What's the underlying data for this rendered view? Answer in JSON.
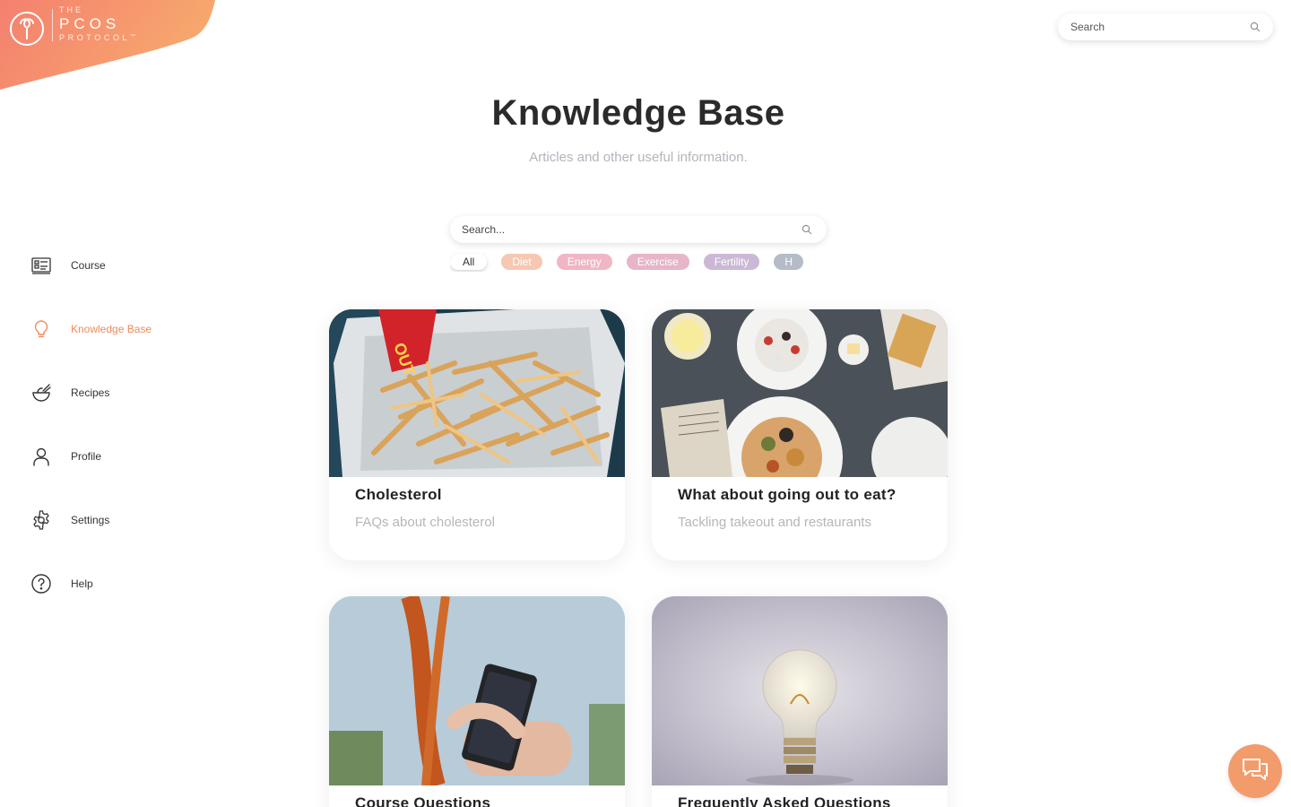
{
  "brand": {
    "line1": "THE",
    "line2": "PCOS",
    "line3": "PROTOCOL",
    "trademark": "™",
    "color_start": "#f5836f",
    "color_end": "#f7a86e"
  },
  "top_search": {
    "placeholder": "Search"
  },
  "header": {
    "title": "Knowledge Base",
    "subtitle": "Articles and other useful information."
  },
  "main_search": {
    "placeholder": "Search..."
  },
  "categories": [
    {
      "label": "All",
      "color": "#ffffff",
      "selected": true
    },
    {
      "label": "Diet",
      "color": "#f6c7b2"
    },
    {
      "label": "Energy",
      "color": "#f0b6c3"
    },
    {
      "label": "Exercise",
      "color": "#e6b5c9"
    },
    {
      "label": "Fertility",
      "color": "#cbb8d6"
    },
    {
      "label": "H",
      "color": "#b5bcc8"
    }
  ],
  "sidebar": {
    "items": [
      {
        "label": "Course",
        "icon": "course-icon"
      },
      {
        "label": "Knowledge Base",
        "icon": "lightbulb-icon",
        "active": true
      },
      {
        "label": "Recipes",
        "icon": "bowl-icon"
      },
      {
        "label": "Profile",
        "icon": "user-icon"
      },
      {
        "label": "Settings",
        "icon": "gear-icon"
      },
      {
        "label": "Help",
        "icon": "question-icon"
      }
    ],
    "accent": "#ef8a57"
  },
  "cards": [
    {
      "title": "Cholesterol",
      "description": "FAQs about cholesterol",
      "image": "fries-photo"
    },
    {
      "title": "What about going out to eat?",
      "description": "Tackling takeout and restaurants",
      "image": "restaurant-table-photo"
    },
    {
      "title": "Course Questions",
      "description": "",
      "image": "phone-hands-photo"
    },
    {
      "title": "Frequently Asked Questions",
      "description": "",
      "image": "lightbulb-photo"
    }
  ],
  "chat": {
    "icon": "chat-icon",
    "color": "#f29c6b"
  }
}
